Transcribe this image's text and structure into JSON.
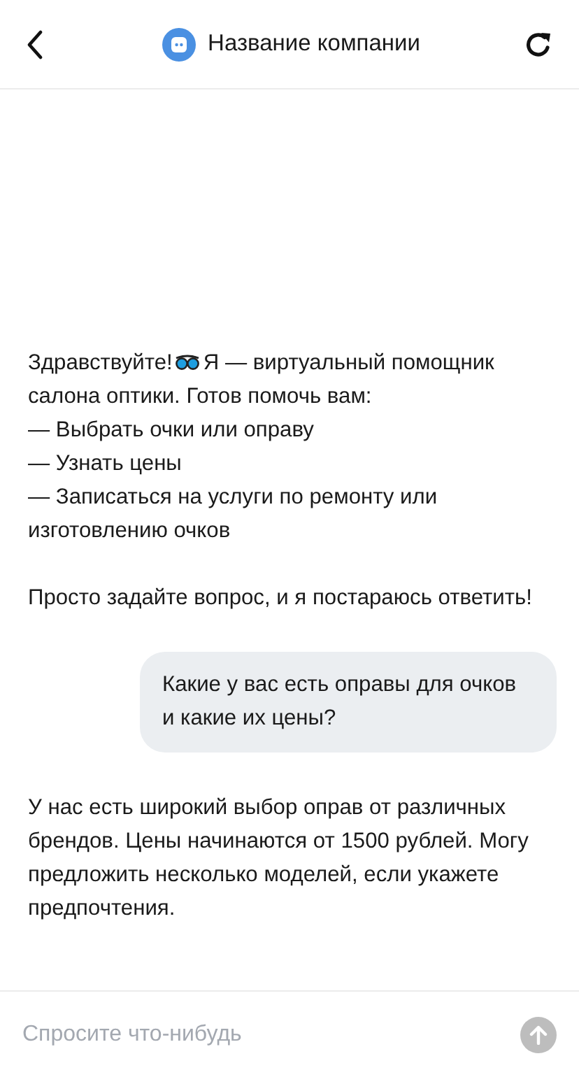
{
  "header": {
    "title": "Название компании"
  },
  "messages": [
    {
      "kind": "bot",
      "greeting": "Здравствуйте!",
      "lead": "Я — виртуальный помощник",
      "text": "салона оптики. Готов помочь вам:",
      "list": [
        "— Выбрать очки или оправу",
        "— Узнать цены",
        "— Записаться на услуги по ремонту или изготовлению очков"
      ],
      "closing": "Просто задайте вопрос, и я постараюсь ответить!"
    },
    {
      "kind": "user",
      "text": "Какие у вас есть оправы для очков и какие их цены?"
    },
    {
      "kind": "bot",
      "text": "У нас есть широкий выбор оправ от различных брендов. Цены начинаются от 1500 рублей. Могу предложить несколько моделей, если укажете предпочтения."
    }
  ],
  "composer": {
    "placeholder": "Спросите что-нибудь",
    "send_disabled": true
  }
}
